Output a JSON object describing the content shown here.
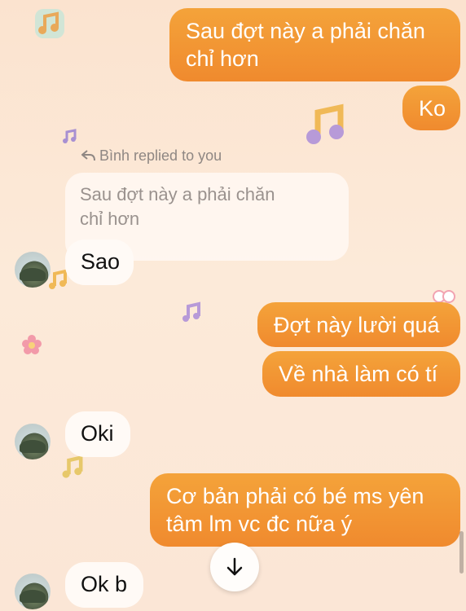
{
  "messages": {
    "m1": "Sau đợt này a phải chăn\nchỉ hơn",
    "m2": "Ko",
    "reply_label": "Bình replied to you",
    "reply_quote": "Sau đợt này a phải chăn\nchỉ hơn",
    "m3": "Sao",
    "m4": "Đợt này lười quá",
    "m5": "Về nhà làm có tí",
    "m6": "Oki",
    "m7": "Cơ bản phải có bé ms yên\ntâm lm vc đc nữa ý",
    "m8": "Ok b"
  },
  "colors": {
    "outgoing_bubble": "#f08a2e",
    "incoming_bubble": "#fffaf6",
    "background": "#fbe3cf"
  },
  "icons": {
    "scroll_down": "arrow-down-icon",
    "reply": "reply-arrow-icon",
    "decor": "music-note-icon"
  }
}
